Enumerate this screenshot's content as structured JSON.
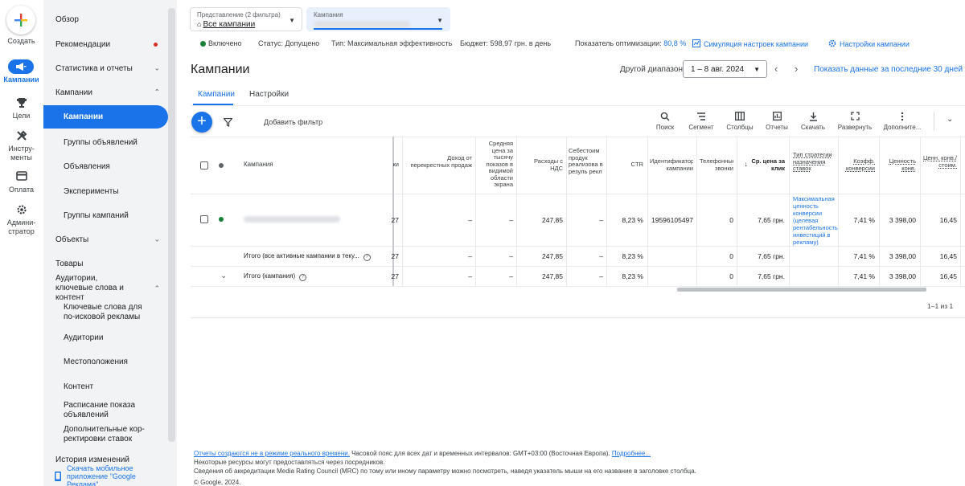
{
  "rail": {
    "create": "Создать",
    "campaigns": "Кампании",
    "goals": "Цели",
    "tools": "Инстру-\nменты",
    "billing": "Оплата",
    "admin": "Админи-\nстратор"
  },
  "nav": {
    "overview": "Обзор",
    "recommendations": "Рекомендации",
    "stats": "Статистика и отчеты",
    "campaigns_group": "Кампании",
    "campaigns": "Кампании",
    "ad_groups": "Группы объявлений",
    "ads": "Объявления",
    "experiments": "Эксперименты",
    "campaign_groups": "Группы кампаний",
    "objects": "Объекты",
    "products": "Товары",
    "audiences_group": "Аудитории, ключевые слова и контент",
    "keywords": "Ключевые слова для по-исковой рекламы",
    "audiences": "Аудитории",
    "locations": "Местоположения",
    "content": "Контент",
    "schedule": "Расписание показа объявлений",
    "bid_adjustments": "Дополнительные кор-ректировки ставок",
    "history": "История изменений",
    "mobile_app": "Скачать мобильное приложение \"Google Реклама\""
  },
  "filters": {
    "view_label": "Представление (2 фильтра)",
    "view_value": "Все кампании",
    "campaign_label": "Кампания"
  },
  "status": {
    "enabled": "Включено",
    "status": "Статус: Допущено",
    "type": "Тип: Максимальная эффективность",
    "budget": "Бюджет: 598,97 грн. в день",
    "optimization_label": "Показатель оптимизации:",
    "optimization_value": "80,8 %",
    "simulate": "Симуляция настроек кампании",
    "settings": "Настройки кампании"
  },
  "header": {
    "title": "Кампании",
    "other_range": "Другой диапазон",
    "date": "1 – 8 авг. 2024",
    "last30": "Показать данные за последние 30 дней"
  },
  "tabs": [
    "Кампании",
    "Настройки"
  ],
  "toolbar": {
    "add_filter": "Добавить фильтр",
    "search": "Поиск",
    "segment": "Сегмент",
    "columns": "Столбцы",
    "reports": "Отчеты",
    "download": "Скачать",
    "expand": "Развернуть",
    "more": "Дополните..."
  },
  "table": {
    "headers": {
      "campaign": "Кампания",
      "c1": "ки",
      "cross_income": "Доход от перекрестных продаж",
      "avg_cpm": "Средняя цена за тысячу показов в видимой области экрана",
      "cost_vat": "Расходы с НДС",
      "cogs": "Себестоим продук реализова в резуль рекл",
      "ctr": "CTR",
      "campaign_id": "Идентификатор кампании",
      "phone": "Телефонные звонки",
      "avg_cpc": "Ср. цена за клик",
      "strategy": "Тип стратегии назначения ставок",
      "conv_rate": "Коэфф. конверсии",
      "conv_value": "Ценность конв.",
      "value_cost": "Ценн. конв./ стоим."
    },
    "row": {
      "c1": "27",
      "cross_income": "–",
      "avg_cpm": "–",
      "cost_vat": "247,85",
      "cogs": "–",
      "ctr": "8,23 %",
      "campaign_id": "19596105497",
      "phone": "0",
      "avg_cpc": "7,65 грн.",
      "strategy": "Максимальная ценность конверсии (целевая рентабельность инвестиций в рекламу)",
      "conv_rate": "7,41 %",
      "conv_value": "3 398,00",
      "value_cost": "16,45"
    },
    "total_active": {
      "label": "Итого (все активные кампании в теку...",
      "c1": "27",
      "cross_income": "–",
      "avg_cpm": "–",
      "cost_vat": "247,85",
      "cogs": "–",
      "ctr": "8,23 %",
      "phone": "0",
      "avg_cpc": "7,65 грн.",
      "conv_rate": "7,41 %",
      "conv_value": "3 398,00",
      "value_cost": "16,45"
    },
    "total_campaign": {
      "label": "Итого (кампания)",
      "c1": "27",
      "cross_income": "–",
      "avg_cpm": "–",
      "cost_vat": "247,85",
      "cogs": "–",
      "ctr": "8,23 %",
      "phone": "0",
      "avg_cpc": "7,65 грн.",
      "conv_rate": "7,41 %",
      "conv_value": "3 398,00",
      "value_cost": "16,45"
    },
    "pager": "1–1 из 1"
  },
  "footer": {
    "line1_link": "Отчеты создаются не в режиме реального времени.",
    "line1_text": " Часовой пояс для всех дат и временных интервалов: GMT+03:00 (Восточная Европа).",
    "line1_more": "Подробнее...",
    "line2": "Некоторые ресурсы могут предоставляться через посредников.",
    "line3": "Сведения об аккредитации Media Rating Council (MRC) по тому или иному параметру можно посмотреть, наведя указатель мыши на его название в заголовке столбца.",
    "line4": "© Google, 2024."
  },
  "colors": {
    "accent": "#1a73e8",
    "status_green": "#188038",
    "alert_red": "#d93025"
  }
}
